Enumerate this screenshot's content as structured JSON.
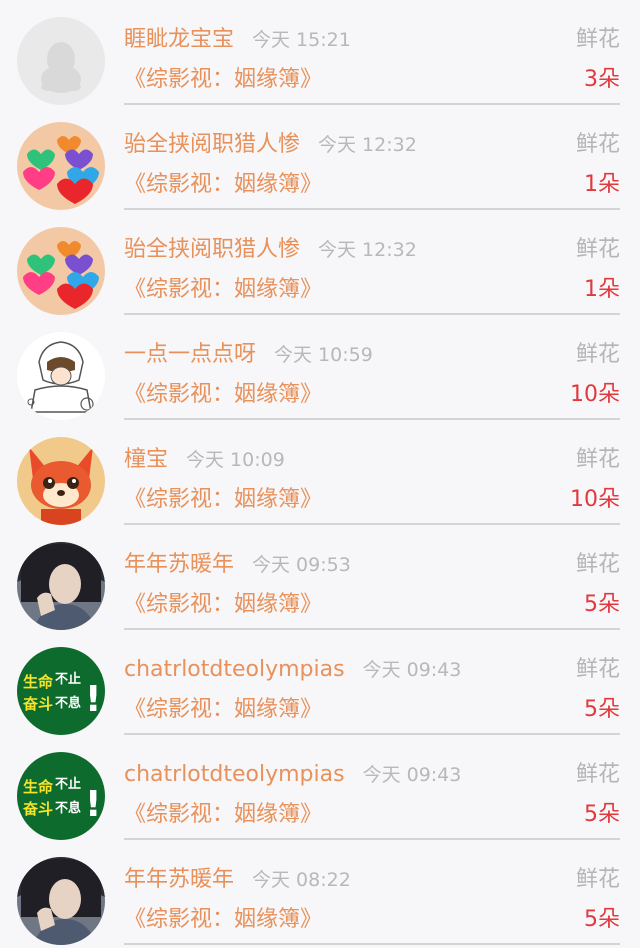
{
  "items": [
    {
      "name": "睚眦龙宝宝",
      "time": "今天 15:21",
      "gift_label": "鲜花",
      "book": "《综影视：姻缘簿》",
      "count": "3朵",
      "avatar": "default-penguin"
    },
    {
      "name": "骀全挟阅职猎人惨",
      "time": "今天 12:32",
      "gift_label": "鲜花",
      "book": "《综影视：姻缘簿》",
      "count": "1朵",
      "avatar": "hearts"
    },
    {
      "name": "骀全挟阅职猎人惨",
      "time": "今天 12:32",
      "gift_label": "鲜花",
      "book": "《综影视：姻缘簿》",
      "count": "1朵",
      "avatar": "hearts"
    },
    {
      "name": "一点一点点呀",
      "time": "今天 10:59",
      "gift_label": "鲜花",
      "book": "《综影视：姻缘簿》",
      "count": "10朵",
      "avatar": "sketch-kid"
    },
    {
      "name": "橦宝",
      "time": "今天 10:09",
      "gift_label": "鲜花",
      "book": "《综影视：姻缘簿》",
      "count": "10朵",
      "avatar": "red-fox"
    },
    {
      "name": "年年苏暖年",
      "time": "今天 09:53",
      "gift_label": "鲜花",
      "book": "《综影视：姻缘簿》",
      "count": "5朵",
      "avatar": "portrait"
    },
    {
      "name": "chatrlotdteolympias",
      "time": "今天 09:43",
      "gift_label": "鲜花",
      "book": "《综影视：姻缘簿》",
      "count": "5朵",
      "avatar": "green-slogan"
    },
    {
      "name": "chatrlotdteolympias",
      "time": "今天 09:43",
      "gift_label": "鲜花",
      "book": "《综影视：姻缘簿》",
      "count": "5朵",
      "avatar": "green-slogan"
    },
    {
      "name": "年年苏暖年",
      "time": "今天 08:22",
      "gift_label": "鲜花",
      "book": "《综影视：姻缘簿》",
      "count": "5朵",
      "avatar": "portrait"
    }
  ],
  "slogan": {
    "line1a": "生命",
    "line1b": "不止",
    "line2a": "奋斗",
    "line2b": "不息",
    "mark": "!"
  },
  "colors": {
    "name": "#e8915a",
    "count": "#e0393e",
    "muted": "#b5b5b5",
    "divider": "#d4d4d4",
    "background": "#f7f6f8"
  }
}
